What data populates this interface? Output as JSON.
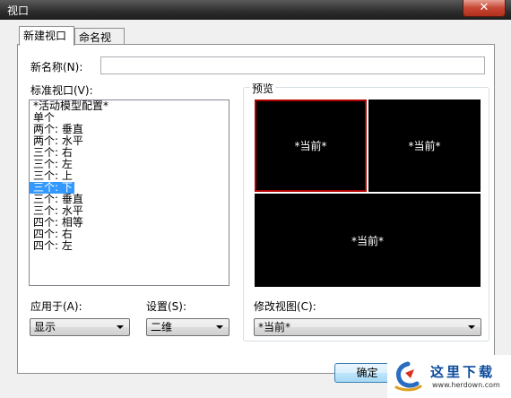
{
  "window": {
    "title": "视口",
    "close_symbol": "✕"
  },
  "tabs": [
    {
      "label": "新建视口",
      "active": true
    },
    {
      "label": "命名视口",
      "active": false
    }
  ],
  "new_name": {
    "label": "新名称(N):",
    "value": ""
  },
  "standard_viewports": {
    "label": "标准视口(V):",
    "items": [
      "*活动模型配置*",
      "单个",
      "两个: 垂直",
      "两个: 水平",
      "三个: 右",
      "三个: 左",
      "三个: 上",
      "三个: 下",
      "三个: 垂直",
      "三个: 水平",
      "四个: 相等",
      "四个: 右",
      "四个: 左"
    ],
    "selected_index": 7
  },
  "preview": {
    "label": "预览",
    "viewport_labels": [
      "*当前*",
      "*当前*",
      "*当前*"
    ]
  },
  "apply_to": {
    "label": "应用于(A):",
    "value": "显示"
  },
  "setup": {
    "label": "设置(S):",
    "value": "二维"
  },
  "change_view": {
    "label": "修改视图(C):",
    "value": "*当前*"
  },
  "buttons": {
    "ok": "确定"
  },
  "watermark": {
    "text": "这里下载",
    "url": "www.herdown.com"
  },
  "colors": {
    "selection": "#3399ff",
    "active_viewport_border": "#b00000",
    "viewport_bg": "#000000"
  }
}
